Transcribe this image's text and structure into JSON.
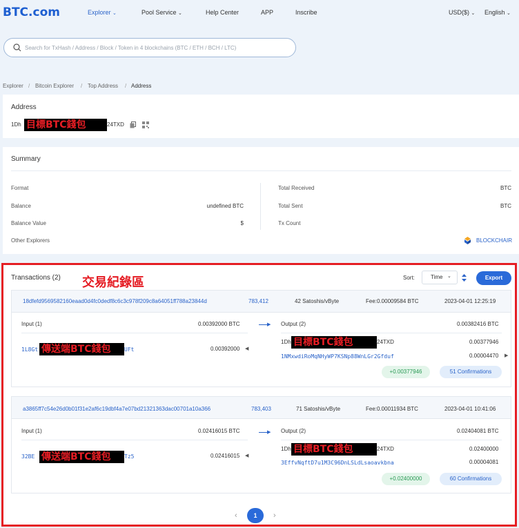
{
  "header": {
    "logo": "BTC.com",
    "nav": [
      {
        "label": "Explorer",
        "active": true
      },
      {
        "label": "Pool Service"
      },
      {
        "label": "Help Center"
      },
      {
        "label": "APP"
      },
      {
        "label": "Inscribe"
      }
    ],
    "currency": "USD($)",
    "language": "English"
  },
  "search": {
    "placeholder": "Search for TxHash / Address / Block / Token in 4 blockchains (BTC / ETH / BCH / LTC)"
  },
  "breadcrumb": [
    "Explorer",
    "Bitcoin Explorer",
    "Top Address",
    "Address"
  ],
  "address_card": {
    "title": "Address",
    "address_prefix": "1Dh",
    "address_suffix": "24TXD",
    "redaction_label": "目標BTC錢包"
  },
  "summary": {
    "title": "Summary",
    "left": [
      {
        "label": "Format",
        "value": ""
      },
      {
        "label": "Balance",
        "value": "undefined BTC"
      },
      {
        "label": "Balance Value",
        "value": "$"
      },
      {
        "label": "Other Explorers",
        "value": ""
      }
    ],
    "right": [
      {
        "label": "Total Received",
        "value": "BTC"
      },
      {
        "label": "Total Sent",
        "value": "BTC"
      },
      {
        "label": "Tx Count",
        "value": ""
      }
    ],
    "blockchair": "BLOCKCHAIR"
  },
  "transactions": {
    "title": "Transactions (2)",
    "annotation": "交易紀錄區",
    "sort_label": "Sort:",
    "sort_value": "Time",
    "export_label": "Export",
    "sender_label": "傳送端BTC錢包",
    "target_label": "目標BTC錢包",
    "items": [
      {
        "hash": "18dfefd9569582160eaad0d4fc0dedf8c6c3c978f209c8a64051ff788a23844d",
        "block": "783,412",
        "fee_rate": "42 Satoshis/vByte",
        "fee": "Fee:0.00009584 BTC",
        "time": "2023-04-01 12:25:19",
        "input_header": "Input (1)",
        "input_total": "0.00392000 BTC",
        "input_addr_prefix": "1L8Gt",
        "input_addr_suffix": "UFt",
        "input_amount": "0.00392000",
        "output_header": "Output (2)",
        "output_total": "0.00382416 BTC",
        "out1_prefix": "1Dh",
        "out1_suffix": "24TXD",
        "out1_amount": "0.00377946",
        "out2_addr": "1NMxwdiRoMqNHyWP7KSNp88WnLGr2Gfduf",
        "out2_amount": "0.00004470",
        "change": "+0.00377946",
        "confirmations": "51 Confirmations"
      },
      {
        "hash": "a3865ff7c54e26d0b01f31e2af6c19dbf4a7e07bd21321363dac00701a10a366",
        "block": "783,403",
        "fee_rate": "71 Satoshis/vByte",
        "fee": "Fee:0.00011934 BTC",
        "time": "2023-04-01 10:41:06",
        "input_header": "Input (1)",
        "input_total": "0.02416015 BTC",
        "input_addr_prefix": "32BE",
        "input_addr_suffix": "Tz5",
        "input_amount": "0.02416015",
        "output_header": "Output (2)",
        "output_total": "0.02404081 BTC",
        "out1_prefix": "1Dh",
        "out1_suffix": "24TXD",
        "out1_amount": "0.02400000",
        "out2_addr": "3EffvNqftD7u1M3C96DnLSLdLsaoavkbna",
        "out2_amount": "0.00004081",
        "change": "+0.02400000",
        "confirmations": "60 Confirmations"
      }
    ]
  },
  "pagination": {
    "prev": "‹",
    "current": "1",
    "next": "›"
  }
}
